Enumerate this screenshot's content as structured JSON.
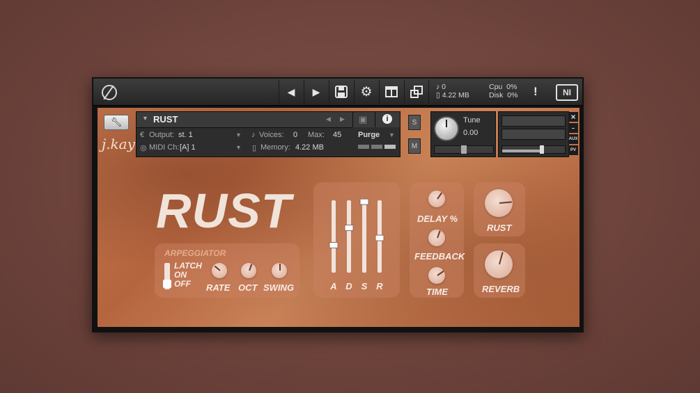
{
  "toolbar": {
    "prev_icon": "triangle-left-icon",
    "next_icon": "triangle-right-icon",
    "save_icon": "floppy-disk-icon",
    "settings_icon": "gear-icon",
    "view_icon": "layout-icon",
    "resize_icon": "resize-icon",
    "voices_count": "0",
    "memory_total": "4.22 MB",
    "cpu_label": "Cpu",
    "cpu_value": "0%",
    "disk_label": "Disk",
    "disk_value": "0%",
    "warning": "!",
    "brand": "NI"
  },
  "header": {
    "instrument_name": "RUST",
    "output_label": "Output:",
    "output_value": "st. 1",
    "voices_label": "Voices:",
    "voices_value": "0",
    "max_label": "Max:",
    "max_value": "45",
    "purge_label": "Purge",
    "midi_label": "MIDI Ch:",
    "midi_value": "[A]  1",
    "memory_label": "Memory:",
    "memory_value": "4.22 MB",
    "solo": "S",
    "mute": "M",
    "tune_label": "Tune",
    "tune_value": "0.00",
    "aux": "AUX",
    "pv": "PV",
    "close": "×",
    "minimize": "–",
    "signature": "j.kay"
  },
  "instrument": {
    "title": "RUST",
    "arp": {
      "heading": "ARPEGGIATOR",
      "latch": "LATCH",
      "on": "ON",
      "off": "OFF",
      "rate": "RATE",
      "oct": "OCT",
      "swing": "SWING"
    },
    "adsr": {
      "labels": [
        "A",
        "D",
        "S",
        "R"
      ],
      "levels": [
        0.38,
        0.62,
        0.98,
        0.48
      ]
    },
    "delay": {
      "delay_label": "DELAY %",
      "feedback_label": "FEEDBACK",
      "time_label": "TIME"
    },
    "rust_label": "RUST",
    "reverb_label": "REVERB"
  },
  "colors": {
    "accent": "#f0e3da",
    "panel": "#b86b44"
  }
}
